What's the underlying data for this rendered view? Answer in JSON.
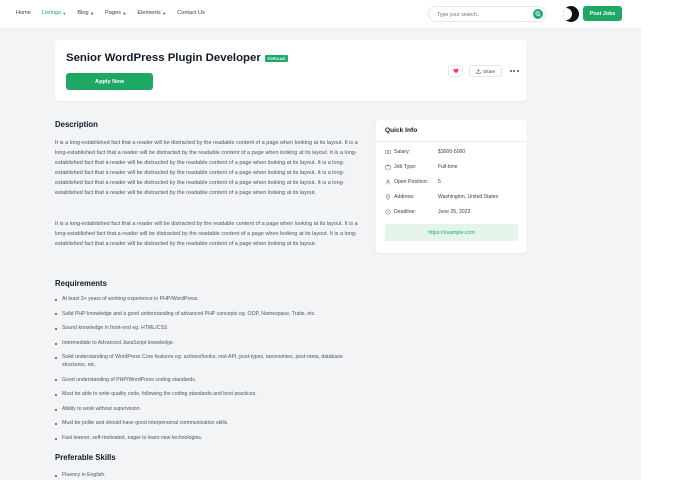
{
  "nav": {
    "items": [
      {
        "label": "Home",
        "dropdown": false,
        "active": false
      },
      {
        "label": "Listings",
        "dropdown": true,
        "active": true
      },
      {
        "label": "Blog",
        "dropdown": true,
        "active": false
      },
      {
        "label": "Pages",
        "dropdown": true,
        "active": false
      },
      {
        "label": "Elements",
        "dropdown": true,
        "active": false
      },
      {
        "label": "Contact Us",
        "dropdown": false,
        "active": false
      }
    ],
    "search_placeholder": "Type your search..",
    "post_button": "Post Jobs"
  },
  "job": {
    "title": "Senior WordPress Plugin Developer",
    "badge": "POPULAR",
    "apply_label": "Apply Now",
    "share_label": "Share"
  },
  "description": {
    "title": "Description",
    "paragraph1": "It is a long-established fact that a reader will be distracted by the readable content of a page when looking at its layout. It is a long-established fact that a reader will be distracted by the readable content of a page when looking at its layout. It is a long-established fact that a reader will be distracted by the readable content of a page when looking at its layout. It is a long-established fact that a reader will be distracted by the readable content of a page when looking at its layout. It is a long-established fact that a reader will be distracted by the readable content of a page when looking at its layout. It is a long-established fact that a reader will be distracted by the readable content of a page when looking at its layout.",
    "paragraph2": "It is a long-established fact that a reader will be distracted by the readable content of a page when looking at its layout. It is a long-established fact that a reader will be distracted by the readable content of a page when looking at its layout. It is a long-established fact that a reader will be distracted by the readable content of a page when looking at its layout."
  },
  "requirements": {
    "title": "Requirements",
    "items": [
      "At least 3+ years of working experience in PHP/WordPress.",
      "Solid PHP knowledge and a good understanding of advanced PHP concepts eg. OOP, Namespace, Traits, etc.",
      "Sound knowledge in front-end eg. HTML/CSS",
      "Intermediate to Advanced JavaScript knowledge.",
      "Solid understanding of WordPress Core features eg: actions/hooks, rest API, post-types, taxonomies, post-meta, database structures, etc.",
      "Good understanding of PHP/WordPress coding standards.",
      "Must be able to write quality code, following the coding standards and best practices.",
      "Ability to work without supervision.",
      "Must be polite and should have good interpersonal communication skills.",
      "Fast learner, self-motivated, eager to learn new technologies."
    ]
  },
  "skills": {
    "title": "Preferable Skills",
    "items": [
      "Fluency in English."
    ]
  },
  "quick_info": {
    "title": "Quick Info",
    "rows": [
      {
        "icon": "money-icon",
        "label": "Salary:",
        "value": "$3000-5000"
      },
      {
        "icon": "briefcase-icon",
        "label": "Job Type:",
        "value": "Full-time"
      },
      {
        "icon": "user-icon",
        "label": "Open Position:",
        "value": "5"
      },
      {
        "icon": "location-pin-icon",
        "label": "Address:",
        "value": "Washington, United States"
      },
      {
        "icon": "clock-icon",
        "label": "Deadline:",
        "value": "June 25, 2022"
      }
    ],
    "link": "https://example.com"
  },
  "colors": {
    "accent": "#1fa765",
    "heart": "#ef4444",
    "background": "#f3f4f6"
  }
}
